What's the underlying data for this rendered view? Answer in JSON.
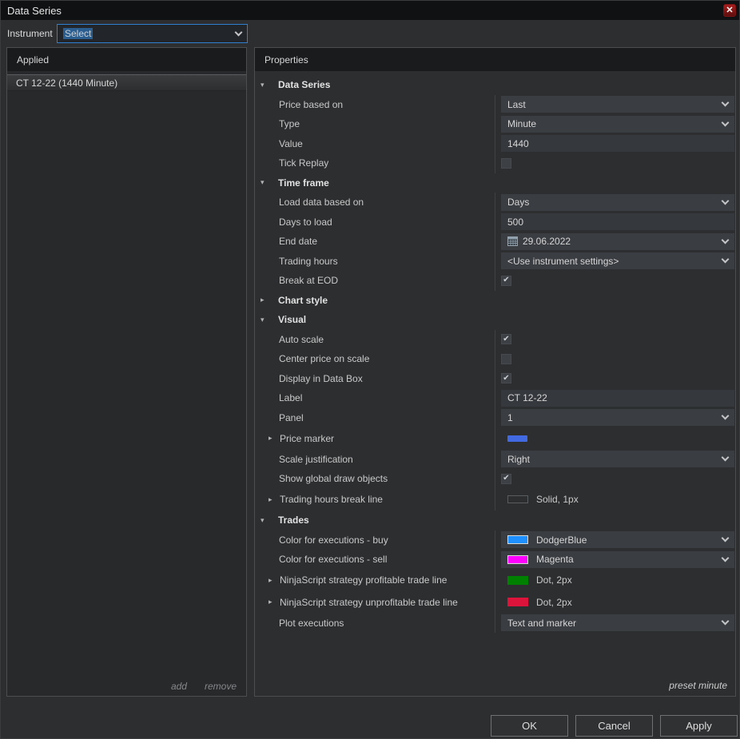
{
  "window": {
    "title": "Data Series",
    "close_glyph": "✕"
  },
  "instrument": {
    "label": "Instrument",
    "value": "Select"
  },
  "applied_panel": {
    "header": "Applied",
    "items": [
      "CT 12-22 (1440 Minute)"
    ],
    "add_label": "add",
    "remove_label": "remove"
  },
  "properties_panel": {
    "header": "Properties",
    "preset_label": "preset minute",
    "rows": [
      {
        "kind": "section",
        "expanded": true,
        "label": "Data Series"
      },
      {
        "kind": "prop",
        "label": "Price based on",
        "control": {
          "type": "dropdown",
          "value": "Last"
        }
      },
      {
        "kind": "prop",
        "label": "Type",
        "control": {
          "type": "dropdown",
          "value": "Minute"
        }
      },
      {
        "kind": "prop",
        "label": "Value",
        "control": {
          "type": "input",
          "value": "1440"
        }
      },
      {
        "kind": "prop",
        "label": "Tick Replay",
        "control": {
          "type": "checkbox",
          "checked": false
        }
      },
      {
        "kind": "section",
        "expanded": true,
        "label": "Time frame"
      },
      {
        "kind": "prop",
        "label": "Load data based on",
        "control": {
          "type": "dropdown",
          "value": "Days"
        }
      },
      {
        "kind": "prop",
        "label": "Days to load",
        "control": {
          "type": "input",
          "value": "500"
        }
      },
      {
        "kind": "prop",
        "label": "End date",
        "control": {
          "type": "dropdown",
          "value": "29.06.2022",
          "icon": "calendar"
        }
      },
      {
        "kind": "prop",
        "label": "Trading hours",
        "control": {
          "type": "dropdown",
          "value": "<Use instrument settings>"
        }
      },
      {
        "kind": "prop",
        "label": "Break at EOD",
        "control": {
          "type": "checkbox",
          "checked": true
        }
      },
      {
        "kind": "section",
        "expanded": false,
        "label": "Chart style"
      },
      {
        "kind": "section",
        "expanded": true,
        "label": "Visual"
      },
      {
        "kind": "prop",
        "label": "Auto scale",
        "control": {
          "type": "checkbox",
          "checked": true
        }
      },
      {
        "kind": "prop",
        "label": "Center price on scale",
        "control": {
          "type": "checkbox",
          "checked": false
        }
      },
      {
        "kind": "prop",
        "label": "Display in Data Box",
        "control": {
          "type": "checkbox",
          "checked": true
        }
      },
      {
        "kind": "prop",
        "label": "Label",
        "control": {
          "type": "input",
          "value": "CT 12-22"
        }
      },
      {
        "kind": "prop",
        "label": "Panel",
        "control": {
          "type": "dropdown",
          "value": "1"
        }
      },
      {
        "kind": "prop",
        "expandable": true,
        "label": "Price marker",
        "control": {
          "type": "swatch",
          "color": "#4169e1"
        }
      },
      {
        "kind": "prop",
        "label": "Scale justification",
        "control": {
          "type": "dropdown",
          "value": "Right"
        }
      },
      {
        "kind": "prop",
        "label": "Show global draw objects",
        "control": {
          "type": "checkbox",
          "checked": true
        }
      },
      {
        "kind": "prop",
        "expandable": true,
        "label": "Trading hours break line",
        "control": {
          "type": "line-sample",
          "value": "Solid, 1px"
        }
      },
      {
        "kind": "section",
        "expanded": true,
        "label": "Trades"
      },
      {
        "kind": "prop",
        "label": "Color for executions - buy",
        "control": {
          "type": "color-dropdown",
          "value": "DodgerBlue",
          "color": "#1e90ff"
        }
      },
      {
        "kind": "prop",
        "label": "Color for executions - sell",
        "control": {
          "type": "color-dropdown",
          "value": "Magenta",
          "color": "#ff00ff"
        }
      },
      {
        "kind": "prop",
        "expandable": true,
        "label": "NinjaScript strategy profitable trade line",
        "control": {
          "type": "color-sample",
          "value": "Dot, 2px",
          "color": "#008000"
        }
      },
      {
        "kind": "prop",
        "expandable": true,
        "label": "NinjaScript strategy unprofitable trade line",
        "control": {
          "type": "color-sample",
          "value": "Dot, 2px",
          "color": "#dc143c"
        }
      },
      {
        "kind": "prop",
        "label": "Plot executions",
        "control": {
          "type": "dropdown",
          "value": "Text and marker"
        }
      }
    ]
  },
  "buttons": {
    "ok": "OK",
    "cancel": "Cancel",
    "apply": "Apply"
  },
  "colors": {
    "price_marker": "#4169e1",
    "buy": "#1e90ff",
    "sell": "#ff00ff",
    "profitable": "#008000",
    "unprofitable": "#dc143c",
    "instrument_border": "#2e7fd0"
  }
}
